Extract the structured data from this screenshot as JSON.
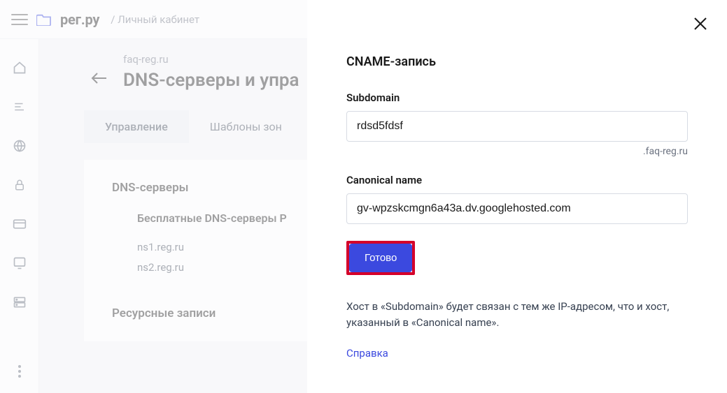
{
  "topbar": {
    "brand": "рег.ру",
    "sub": "/ Личный кабинет"
  },
  "page": {
    "crumb": "faq-reg.ru",
    "title": "DNS-серверы и упра"
  },
  "tabs": {
    "manage": "Управление",
    "templates": "Шаблоны зон"
  },
  "dns": {
    "section": "DNS-серверы",
    "free_heading": "Бесплатные DNS-серверы Р",
    "ns1": "ns1.reg.ru",
    "ns2": "ns2.reg.ru",
    "records_heading": "Ресурсные записи"
  },
  "modal": {
    "title": "CNAME-запись",
    "subdomain_label": "Subdomain",
    "subdomain_value": "rdsd5fdsf",
    "subdomain_suffix": ".faq-reg.ru",
    "cname_label": "Canonical name",
    "cname_value": "gv-wpzskcmgn6a43a.dv.googlehosted.com",
    "submit": "Готово",
    "hint": "Хост в «Subdomain» будет связан с тем же IP-адресом, что и хост, указанный в «Canonical name».",
    "help": "Справка"
  }
}
